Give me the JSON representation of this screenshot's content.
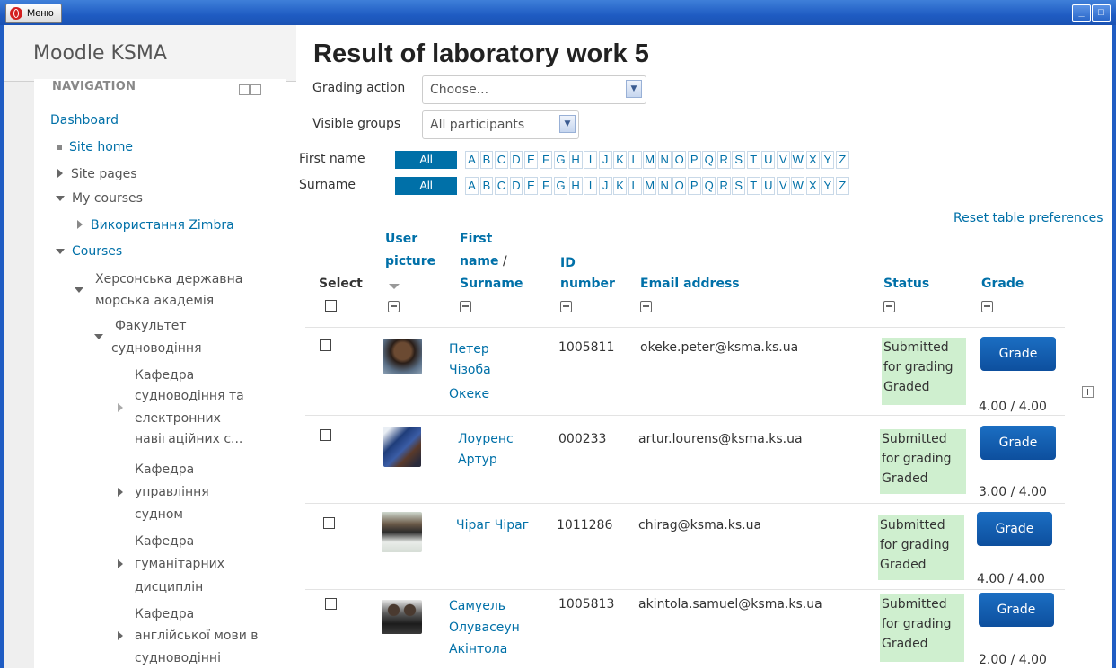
{
  "window": {
    "menu_label": "Меню"
  },
  "site": {
    "brand": "Moodle KSMA"
  },
  "nav": {
    "heading": "NAVIGATION",
    "dashboard": "Dashboard",
    "site_home": "Site home",
    "site_pages": "Site pages",
    "my_courses": "My courses",
    "course_zimbra": "Використання Zimbra",
    "courses": "Courses",
    "academy_l1": "Херсонська державна",
    "academy_l2": "морська академія",
    "faculty_l1": "Факультет",
    "faculty_l2": "судноводіння",
    "dept1": [
      "Кафедра",
      "судноводіння та",
      "електронних",
      "навігаційних с..."
    ],
    "dept2": [
      "Кафедра",
      "управління",
      "судном"
    ],
    "dept3": [
      "Кафедра",
      "гуманітарних",
      "дисциплін"
    ],
    "dept4": [
      "Кафедра",
      "англійської мови в",
      "судноводінні"
    ]
  },
  "main": {
    "title": "Result of laboratory work 5",
    "grading_action_label": "Grading action",
    "grading_action_value": "Choose...",
    "visible_groups_label": "Visible groups",
    "visible_groups_value": "All participants",
    "first_name_label": "First name",
    "surname_label": "Surname",
    "all_label": "All",
    "letters": [
      "A",
      "B",
      "C",
      "D",
      "E",
      "F",
      "G",
      "H",
      "I",
      "J",
      "K",
      "L",
      "M",
      "N",
      "O",
      "P",
      "Q",
      "R",
      "S",
      "T",
      "U",
      "V",
      "W",
      "X",
      "Y",
      "Z"
    ],
    "reset_link": "Reset table preferences"
  },
  "table": {
    "headers": {
      "select": "Select",
      "user_picture_l1": "User",
      "user_picture_l2": "picture",
      "name_l1": "First",
      "name_l2": "name",
      "name_sep": " /",
      "name_l3": "Surname",
      "id_l1": "ID",
      "id_l2": "number",
      "email": "Email address",
      "status": "Status",
      "grade": "Grade"
    },
    "grade_button": "Grade",
    "rows": [
      {
        "name": [
          "Петер",
          "Чізоба",
          "Океке"
        ],
        "id": "1005811",
        "email": "okeke.peter@ksma.ks.ua",
        "status": [
          "Submitted",
          "for grading",
          "Graded"
        ],
        "grade": "4.00 / 4.00"
      },
      {
        "name": [
          "Лоуренс",
          "Артур"
        ],
        "id": "000233",
        "email": "artur.lourens@ksma.ks.ua",
        "status": [
          "Submitted",
          "for grading",
          "Graded"
        ],
        "grade": "3.00 / 4.00"
      },
      {
        "name": [
          "Чіраг Чіраг"
        ],
        "id": "1011286",
        "email": "chirag@ksma.ks.ua",
        "status": [
          "Submitted",
          "for grading",
          "Graded"
        ],
        "grade": "4.00 / 4.00"
      },
      {
        "name": [
          "Самуель",
          "Олувасеун",
          "Акінтола"
        ],
        "id": "1005813",
        "email": "akintola.samuel@ksma.ks.ua",
        "status": [
          "Submitted",
          "for grading",
          "Graded"
        ],
        "grade": "2.00 / 4.00"
      }
    ]
  }
}
